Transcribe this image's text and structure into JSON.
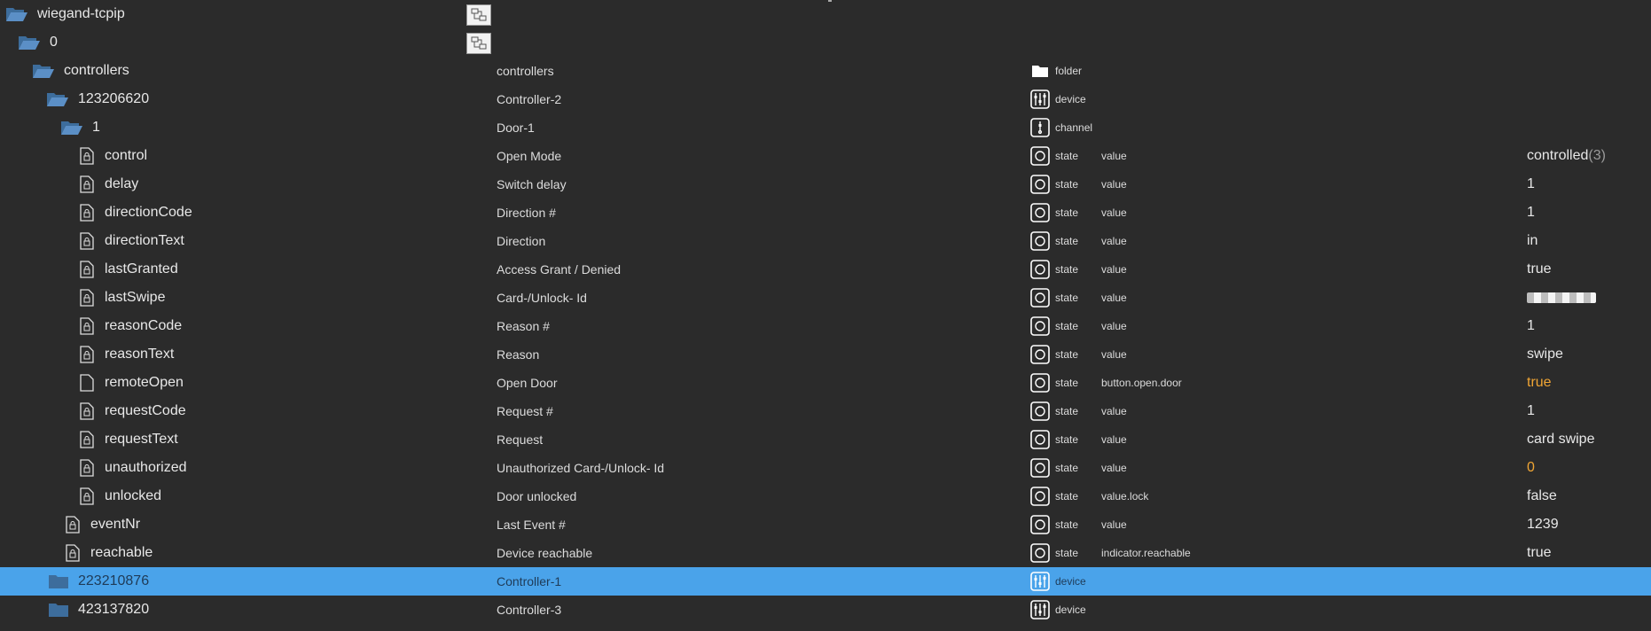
{
  "rows": [
    {
      "name": "wiegand-tcpip",
      "title": "",
      "type": "",
      "role": "",
      "value": ""
    },
    {
      "name": "0",
      "title": "",
      "type": "",
      "role": "",
      "value": ""
    },
    {
      "name": "controllers",
      "title": "controllers",
      "type": "folder",
      "role": "",
      "value": ""
    },
    {
      "name": "123206620",
      "title": "Controller-2",
      "type": "device",
      "role": "",
      "value": ""
    },
    {
      "name": "1",
      "title": "Door-1",
      "type": "channel",
      "role": "",
      "value": ""
    },
    {
      "name": "control",
      "title": "Open Mode",
      "type": "state",
      "role": "value",
      "value": "controlled",
      "value_suffix": "(3)"
    },
    {
      "name": "delay",
      "title": "Switch delay",
      "type": "state",
      "role": "value",
      "value": "1"
    },
    {
      "name": "directionCode",
      "title": "Direction #",
      "type": "state",
      "role": "value",
      "value": "1"
    },
    {
      "name": "directionText",
      "title": "Direction",
      "type": "state",
      "role": "value",
      "value": "in"
    },
    {
      "name": "lastGranted",
      "title": "Access Grant / Denied",
      "type": "state",
      "role": "value",
      "value": "true"
    },
    {
      "name": "lastSwipe",
      "title": "Card-/Unlock- Id",
      "type": "state",
      "role": "value",
      "value": ""
    },
    {
      "name": "reasonCode",
      "title": "Reason #",
      "type": "state",
      "role": "value",
      "value": "1"
    },
    {
      "name": "reasonText",
      "title": "Reason",
      "type": "state",
      "role": "value",
      "value": "swipe"
    },
    {
      "name": "remoteOpen",
      "title": "Open Door",
      "type": "state",
      "role": "button.open.door",
      "value": "true"
    },
    {
      "name": "requestCode",
      "title": "Request #",
      "type": "state",
      "role": "value",
      "value": "1"
    },
    {
      "name": "requestText",
      "title": "Request",
      "type": "state",
      "role": "value",
      "value": "card swipe"
    },
    {
      "name": "unauthorized",
      "title": "Unauthorized Card-/Unlock- Id",
      "type": "state",
      "role": "value",
      "value": "0"
    },
    {
      "name": "unlocked",
      "title": "Door unlocked",
      "type": "state",
      "role": "value.lock",
      "value": "false"
    },
    {
      "name": "eventNr",
      "title": "Last Event #",
      "type": "state",
      "role": "value",
      "value": "1239"
    },
    {
      "name": "reachable",
      "title": "Device reachable",
      "type": "state",
      "role": "indicator.reachable",
      "value": "true"
    },
    {
      "name": "223210876",
      "title": "Controller-1",
      "type": "device",
      "role": "",
      "value": ""
    },
    {
      "name": "423137820",
      "title": "Controller-3",
      "type": "device",
      "role": "",
      "value": ""
    }
  ],
  "colors": {
    "background": "#2b2b2b",
    "selected": "#4aa3ea",
    "folder": "#4a7fb5",
    "highlight_value": "#f0a534"
  },
  "icons": {
    "folder_open": "folder-open-icon",
    "folder_closed": "folder-closed-icon",
    "state_doc": "state-file-icon",
    "type_folder": "folder-icon",
    "type_device": "device-icon",
    "type_channel": "channel-icon",
    "type_state": "state-icon",
    "adapter": "adapter-icon"
  }
}
